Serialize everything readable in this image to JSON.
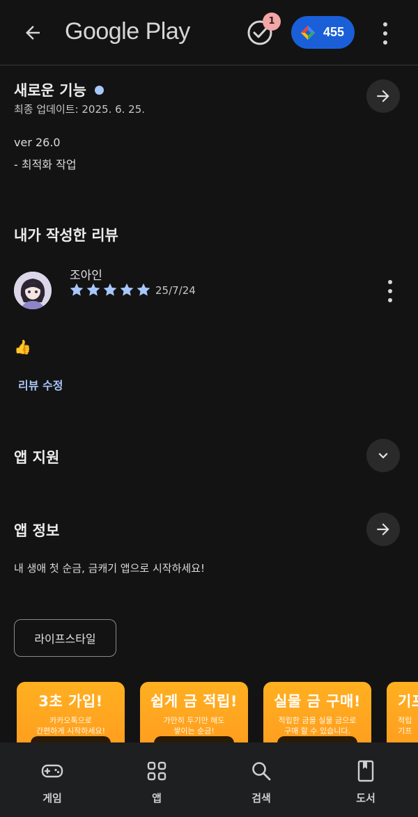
{
  "header": {
    "logo_text": "Google Play",
    "notification_count": "1",
    "points_value": "455"
  },
  "whats_new": {
    "title": "새로운 기능",
    "updated": "최종 업데이트: 2025. 6. 25.",
    "version": "ver 26.0",
    "notes": "- 최적화 작업"
  },
  "my_review": {
    "title": "내가 작성한 리뷰",
    "reviewer": "조아인",
    "rating": 5,
    "date": "25/7/24",
    "content": "👍",
    "edit_label": "리뷰 수정"
  },
  "app_support": {
    "title": "앱 지원"
  },
  "app_info": {
    "title": "앱 정보",
    "description": "내 생애 첫 순금, 금캐기 앱으로 시작하세요!",
    "category_chip": "라이프스타일"
  },
  "screenshots": [
    {
      "title": "3초 가입!",
      "line1": "카카오톡으로",
      "line2": "간편하게 시작하세요!"
    },
    {
      "title": "쉽게 금 적립!",
      "line1": "가만히 두기만 해도",
      "line2": "쌓이는 순금!"
    },
    {
      "title": "실물 금 구매!",
      "line1": "적립한 금을 실물 금으로",
      "line2": "구매 할 수 있습니다."
    },
    {
      "title": "기프",
      "line1": "적립",
      "line2": "기프"
    }
  ],
  "bottom_nav": {
    "games": "게임",
    "apps": "앱",
    "search": "검색",
    "books": "도서"
  },
  "colors": {
    "background": "#131313",
    "accent_blue": "#a8c7fa",
    "points_pill": "#1a5fd8",
    "promo_orange": "#ffa51f"
  }
}
